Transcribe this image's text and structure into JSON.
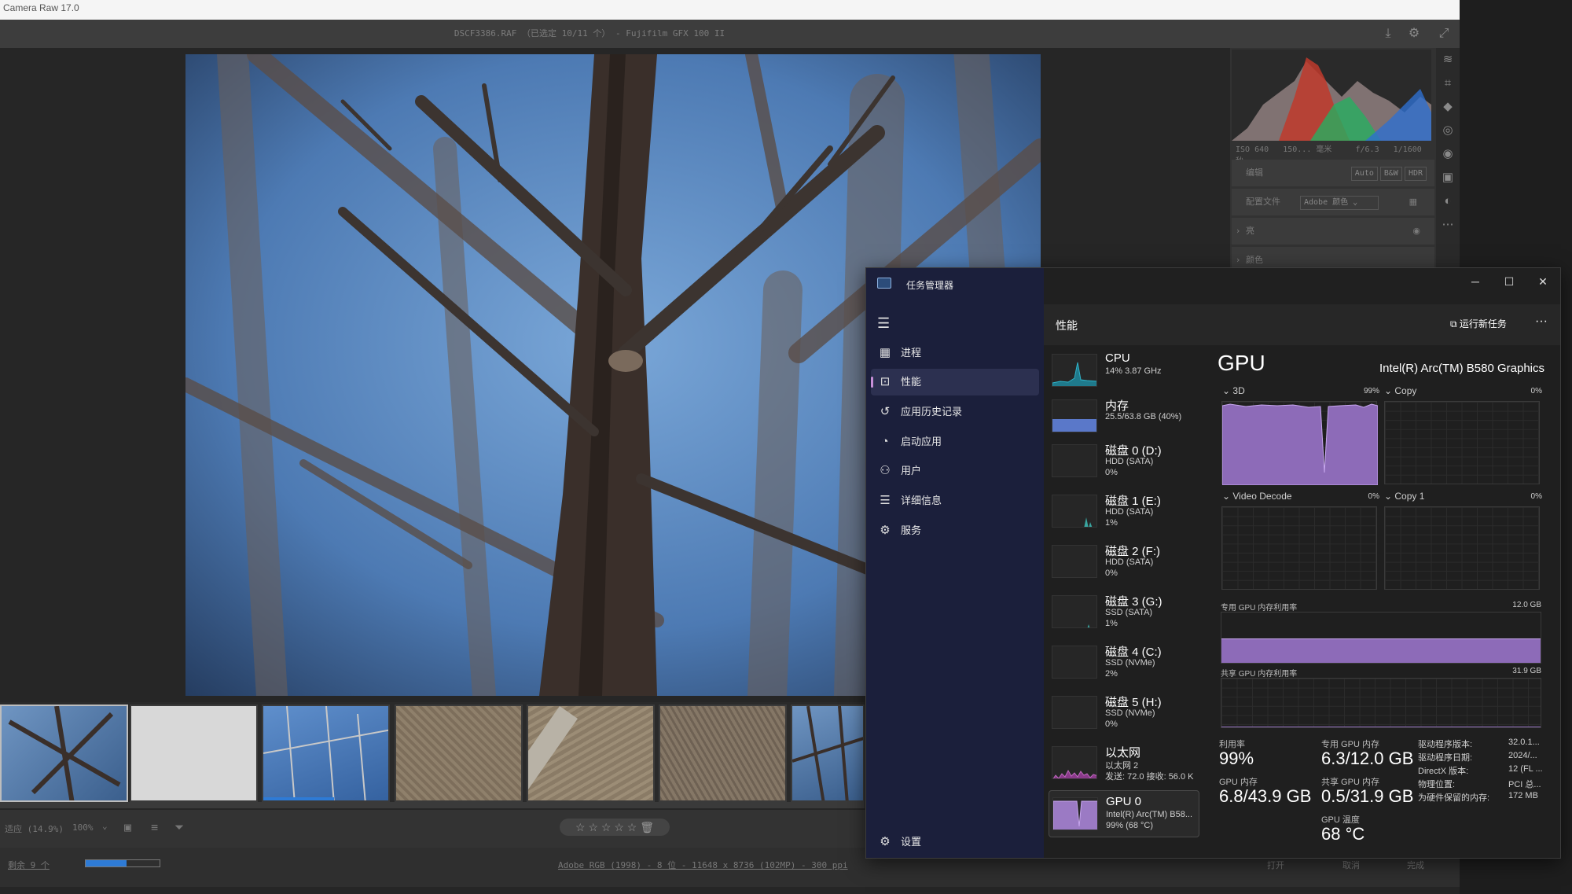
{
  "camera_raw": {
    "window_title": "Camera Raw 17.0",
    "file_info": "DSCF3386.RAF  （已选定 10/11 个） -  Fujifilm GFX 100 II",
    "histogram_info": {
      "iso": "ISO 640",
      "focal": "150... 毫米",
      "aperture": "f/6.3",
      "shutter": "1/1600 秒"
    },
    "edit_label": "编辑",
    "edit_buttons": [
      "Auto",
      "B&W",
      "HDR"
    ],
    "profile_label": "配置文件",
    "profile_value": "Adobe 颜色",
    "sections": [
      "亮",
      "颜色"
    ],
    "zoom_fit": "适应 (14.9%)",
    "zoom_100": "100%",
    "rating_stars": "☆ ☆ ☆ ☆ ☆",
    "remaining": "剩余 9 个",
    "workflow_info": "Adobe RGB (1998) - 8 位 - 11648 x 8736 (102MP) - 300 ppi",
    "footer_buttons": [
      "打开",
      "取消",
      "完成"
    ],
    "progress": 0.55
  },
  "task_manager": {
    "title": "任务管理器",
    "controls": {
      "minimize": "─",
      "maximize": "☐",
      "close": "✕"
    },
    "nav": [
      {
        "label": "进程",
        "icon": "processes-icon"
      },
      {
        "label": "性能",
        "icon": "performance-icon",
        "active": true
      },
      {
        "label": "应用历史记录",
        "icon": "app-history-icon"
      },
      {
        "label": "启动应用",
        "icon": "startup-apps-icon"
      },
      {
        "label": "用户",
        "icon": "users-icon"
      },
      {
        "label": "详细信息",
        "icon": "details-icon"
      },
      {
        "label": "服务",
        "icon": "services-icon"
      }
    ],
    "settings_label": "设置",
    "page_title": "性能",
    "run_new_task": "运行新任务",
    "more": "···",
    "devices": [
      {
        "name": "CPU",
        "line1": "14%  3.87 GHz",
        "line2": ""
      },
      {
        "name": "内存",
        "line1": "25.5/63.8 GB (40%)",
        "line2": ""
      },
      {
        "name": "磁盘 0 (D:)",
        "line1": "HDD (SATA)",
        "line2": "0%"
      },
      {
        "name": "磁盘 1 (E:)",
        "line1": "HDD (SATA)",
        "line2": "1%"
      },
      {
        "name": "磁盘 2 (F:)",
        "line1": "HDD (SATA)",
        "line2": "0%"
      },
      {
        "name": "磁盘 3 (G:)",
        "line1": "SSD (SATA)",
        "line2": "1%"
      },
      {
        "name": "磁盘 4 (C:)",
        "line1": "SSD (NVMe)",
        "line2": "2%"
      },
      {
        "name": "磁盘 5 (H:)",
        "line1": "SSD (NVMe)",
        "line2": "0%"
      },
      {
        "name": "以太网",
        "line1": "以太网 2",
        "line2": "发送: 72.0  接收: 56.0 K"
      },
      {
        "name": "GPU 0",
        "line1": "Intel(R) Arc(TM) B58...",
        "line2": "99%  (68 °C)"
      }
    ],
    "gpu": {
      "heading": "GPU",
      "model": "Intel(R) Arc(TM) B580 Graphics",
      "engines": [
        {
          "name": "3D",
          "pct": "99%"
        },
        {
          "name": "Copy",
          "pct": "0%"
        },
        {
          "name": "Video Decode",
          "pct": "0%"
        },
        {
          "name": "Copy 1",
          "pct": "0%"
        }
      ],
      "dedicated_label": "专用 GPU 内存利用率",
      "dedicated_max": "12.0 GB",
      "shared_label": "共享 GPU 内存利用率",
      "shared_max": "31.9 GB",
      "stats": [
        {
          "label": "利用率",
          "value": "99%"
        },
        {
          "label": "专用 GPU 内存",
          "value": "6.3/12.0 GB"
        },
        {
          "label": "GPU 内存",
          "value": "6.8/43.9 GB"
        },
        {
          "label": "共享 GPU 内存",
          "value": "0.5/31.9 GB"
        },
        {
          "label": "GPU 温度",
          "value": "68 °C"
        }
      ],
      "info": [
        {
          "k": "驱动程序版本:",
          "v": "32.0.1..."
        },
        {
          "k": "驱动程序日期:",
          "v": "2024/..."
        },
        {
          "k": "DirectX 版本:",
          "v": "12 (FL ..."
        },
        {
          "k": "物理位置:",
          "v": "PCI 总..."
        },
        {
          "k": "为硬件保留的内存:",
          "v": "172 MB"
        }
      ]
    }
  }
}
